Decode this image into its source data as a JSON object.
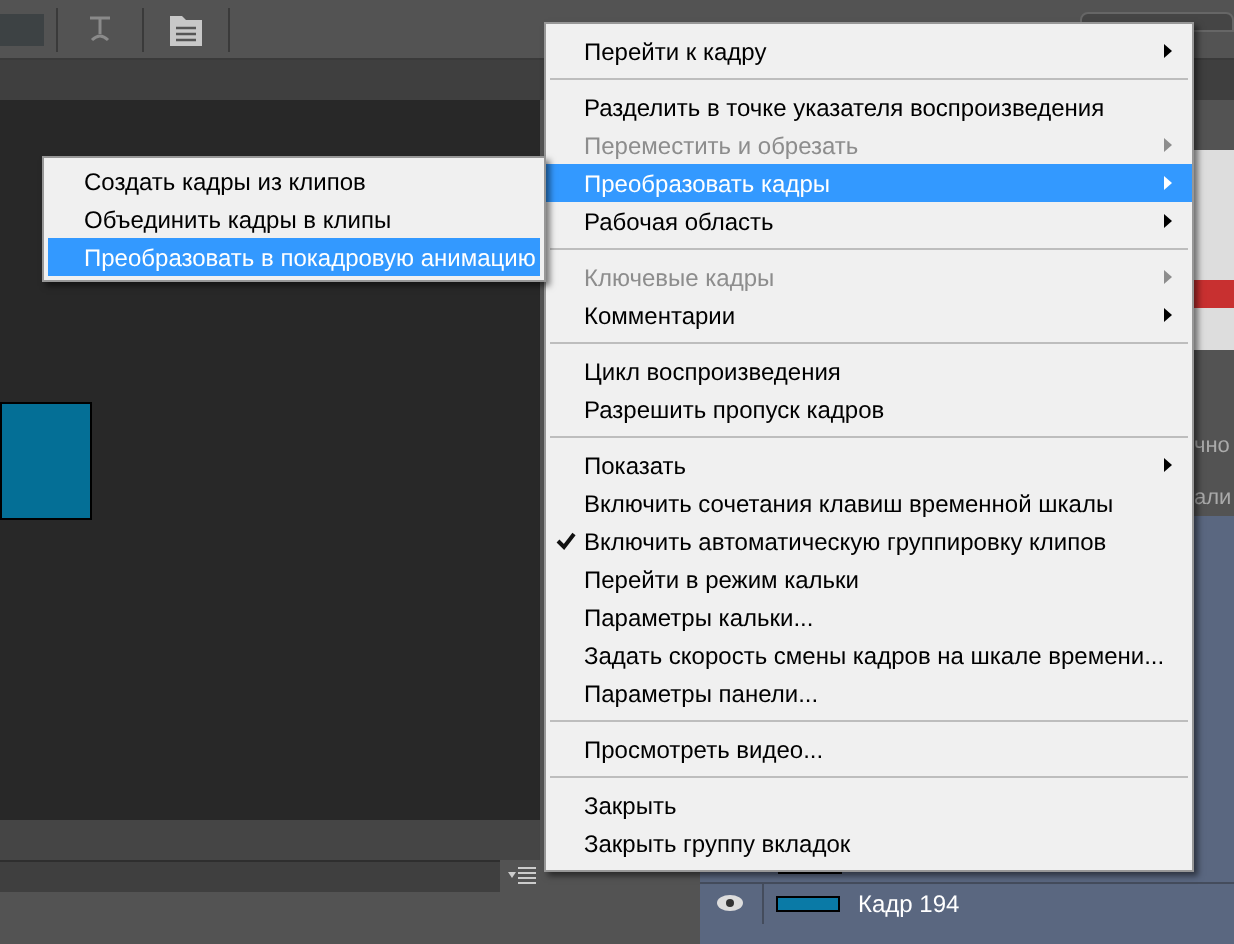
{
  "context_menu": {
    "items": [
      {
        "kind": "item",
        "label": "Перейти к кадру",
        "submenu": true,
        "disabled": false,
        "selected": false,
        "checked": false
      },
      {
        "kind": "separator"
      },
      {
        "kind": "item",
        "label": "Разделить в точке указателя воспроизведения",
        "submenu": false,
        "disabled": false,
        "selected": false,
        "checked": false
      },
      {
        "kind": "item",
        "label": "Переместить и обрезать",
        "submenu": true,
        "disabled": true,
        "selected": false,
        "checked": false
      },
      {
        "kind": "item",
        "label": "Преобразовать кадры",
        "submenu": true,
        "disabled": false,
        "selected": true,
        "checked": false
      },
      {
        "kind": "item",
        "label": "Рабочая область",
        "submenu": true,
        "disabled": false,
        "selected": false,
        "checked": false
      },
      {
        "kind": "separator"
      },
      {
        "kind": "item",
        "label": "Ключевые кадры",
        "submenu": true,
        "disabled": true,
        "selected": false,
        "checked": false
      },
      {
        "kind": "item",
        "label": "Комментарии",
        "submenu": true,
        "disabled": false,
        "selected": false,
        "checked": false
      },
      {
        "kind": "separator"
      },
      {
        "kind": "item",
        "label": "Цикл воспроизведения",
        "submenu": false,
        "disabled": false,
        "selected": false,
        "checked": false
      },
      {
        "kind": "item",
        "label": "Разрешить пропуск кадров",
        "submenu": false,
        "disabled": false,
        "selected": false,
        "checked": false
      },
      {
        "kind": "separator"
      },
      {
        "kind": "item",
        "label": "Показать",
        "submenu": true,
        "disabled": false,
        "selected": false,
        "checked": false
      },
      {
        "kind": "item",
        "label": "Включить сочетания клавиш временной шкалы",
        "submenu": false,
        "disabled": false,
        "selected": false,
        "checked": false
      },
      {
        "kind": "item",
        "label": "Включить автоматическую группировку клипов",
        "submenu": false,
        "disabled": false,
        "selected": false,
        "checked": true
      },
      {
        "kind": "item",
        "label": "Перейти в режим кальки",
        "submenu": false,
        "disabled": false,
        "selected": false,
        "checked": false
      },
      {
        "kind": "item",
        "label": "Параметры кальки...",
        "submenu": false,
        "disabled": false,
        "selected": false,
        "checked": false
      },
      {
        "kind": "item",
        "label": "Задать скорость смены кадров на шкале времени...",
        "submenu": false,
        "disabled": false,
        "selected": false,
        "checked": false
      },
      {
        "kind": "item",
        "label": "Параметры панели...",
        "submenu": false,
        "disabled": false,
        "selected": false,
        "checked": false
      },
      {
        "kind": "separator"
      },
      {
        "kind": "item",
        "label": "Просмотреть видео...",
        "submenu": false,
        "disabled": false,
        "selected": false,
        "checked": false
      },
      {
        "kind": "separator"
      },
      {
        "kind": "item",
        "label": "Закрыть",
        "submenu": false,
        "disabled": false,
        "selected": false,
        "checked": false
      },
      {
        "kind": "item",
        "label": "Закрыть группу вкладок",
        "submenu": false,
        "disabled": false,
        "selected": false,
        "checked": false
      }
    ]
  },
  "submenu": {
    "items": [
      {
        "label": "Создать кадры из клипов",
        "selected": false
      },
      {
        "label": "Объединить кадры в клипы",
        "selected": false
      },
      {
        "label": "Преобразовать в покадровую анимацию",
        "selected": true
      }
    ]
  },
  "layers_panel": {
    "header_fragments": [
      "чно",
      "али"
    ],
    "layers": [
      {
        "name": "Кадр 194"
      }
    ]
  }
}
